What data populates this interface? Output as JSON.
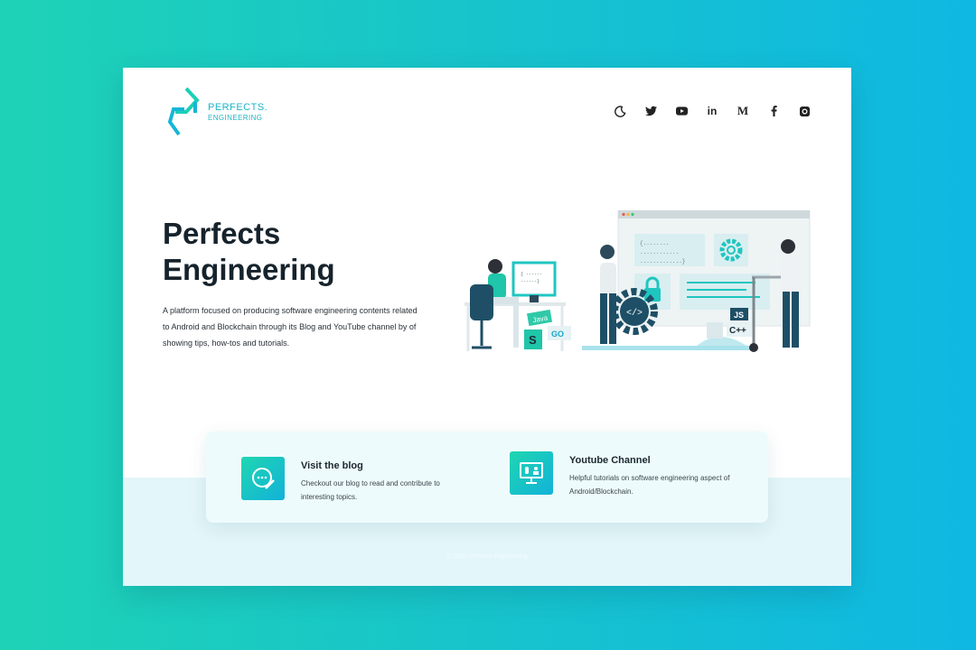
{
  "brand": {
    "line1": "PERFECTS.",
    "line2": "ENGINEERING",
    "color": "#1bb5c8"
  },
  "nav": {
    "icons": [
      "moon-icon",
      "twitter-icon",
      "youtube-icon",
      "linkedin-icon",
      "medium-icon",
      "facebook-icon",
      "instagram-icon"
    ],
    "medium_glyph": "M",
    "linkedin_glyph": "in"
  },
  "hero": {
    "title": "Perfects\nEngineering",
    "description": "A platform  focused on producing software engineering contents related to Android and Blockchain through its Blog and YouTube channel by of showing tips, how-tos and tutorials."
  },
  "illustration": {
    "badges": [
      "Java",
      "GO",
      "JS",
      "C++",
      "S"
    ]
  },
  "cards": [
    {
      "title": "Visit the blog",
      "text": "Checkout our blog to read and contribute to interesting topics.",
      "icon": "chat-edit-icon"
    },
    {
      "title": "Youtube Channel",
      "text": "Helpful tutorials on software engineering aspect of Android/Blockchain.",
      "icon": "monitor-video-icon"
    }
  ],
  "footer": {
    "text": "© 2020 Perfects Engineering"
  },
  "colors": {
    "accent": "#1ed2b6",
    "accent2": "#0fb8e2",
    "heading": "#16232c",
    "band": "#e3f6f9"
  }
}
